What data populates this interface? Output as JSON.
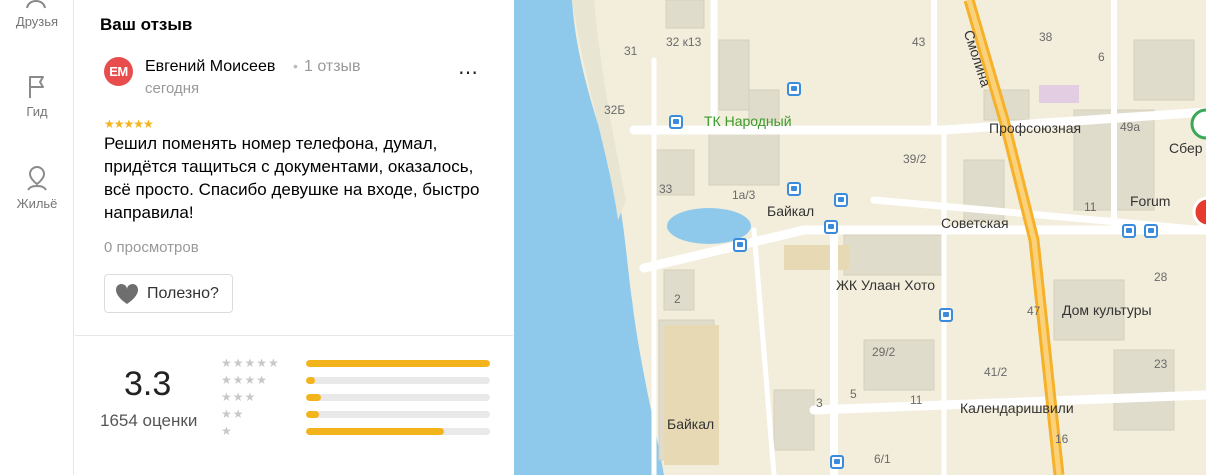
{
  "nav": {
    "items": [
      {
        "label": "Друзья"
      },
      {
        "label": "Гид"
      },
      {
        "label": "Жильё"
      }
    ]
  },
  "review": {
    "section_title": "Ваш отзыв",
    "avatar_initials": "ЕМ",
    "author": "Евгений Моисеев",
    "author_reviews": "1 отзыв",
    "date": "сегодня",
    "stars": "★★★★★",
    "text": "Решил поменять номер телефона, думал, придётся тащиться с документами, оказалось, всё просто. Спасибо девушке на входе, быстро направила!",
    "views": "0 просмотров",
    "useful_label": "Полезно?",
    "more_icon": "⋯"
  },
  "rating": {
    "value": "3.3",
    "count_label": "1654 оценки",
    "distribution": [
      {
        "stars": "★★★★★",
        "fraction": 1.0
      },
      {
        "stars": "★★★★",
        "fraction": 0.05
      },
      {
        "stars": "★★★",
        "fraction": 0.08
      },
      {
        "stars": "★★",
        "fraction": 0.07
      },
      {
        "stars": "★",
        "fraction": 0.75
      }
    ],
    "accent_color": "#f3b41b"
  },
  "map": {
    "labels": {
      "tk_narodny": "ТК Народный",
      "baikal_1": "Байкал",
      "baikal_2": "Байкал",
      "sovetskaya": "Советская",
      "profsoyuznaya": "Профсоюзная",
      "smolina": "Смолина",
      "zhk": "ЖК Улаан Хото",
      "dom_kultury": "Дом культуры",
      "kalandarishvili": "Календаришвили",
      "forum": "Forum",
      "sber": "Сбер",
      "n31": "31",
      "n32k13": "32 к13",
      "n43": "43",
      "n38": "38",
      "n6": "6",
      "n32b": "32Б",
      "n49a": "49а",
      "n39_2": "39/2",
      "n33": "33",
      "n1a3": "1а/3",
      "n11": "11",
      "n28": "28",
      "n2": "2",
      "n47": "47",
      "n29_2": "29/2",
      "n23": "23",
      "n41_2": "41/2",
      "n3": "3",
      "n5": "5",
      "n11b": "11",
      "n16": "16",
      "n6_1": "6/1"
    }
  }
}
